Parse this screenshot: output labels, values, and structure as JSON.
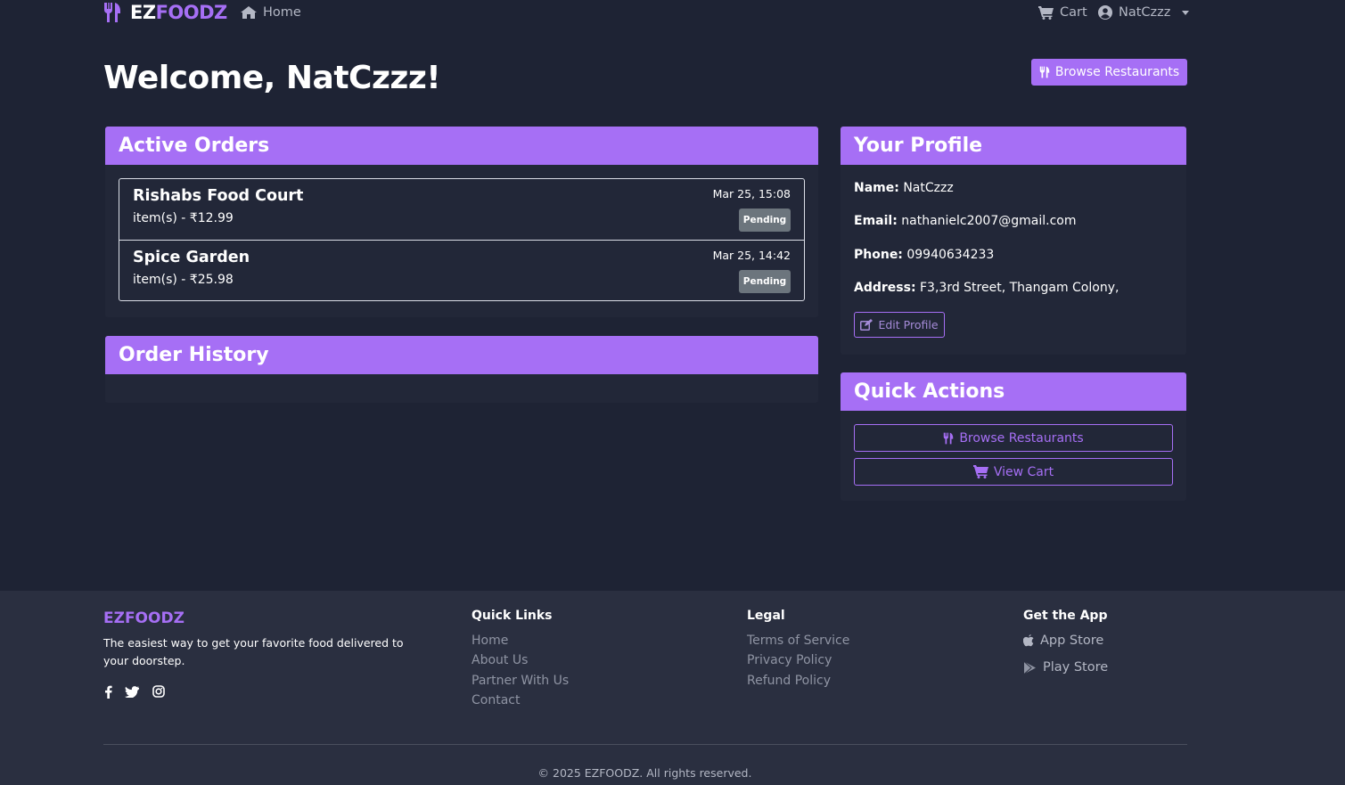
{
  "navbar": {
    "brand_ez": "EZ",
    "brand_foodz": "FOODZ",
    "home": "Home",
    "cart": "Cart",
    "user": "NatCzzz"
  },
  "main": {
    "welcome": "Welcome, NatCzzz!",
    "browse_button": "Browse Restaurants"
  },
  "active_orders": {
    "title": "Active Orders",
    "orders": [
      {
        "name": "Rishabs Food Court",
        "desc": "item(s) - ₹12.99",
        "date": "Mar 25, 15:08",
        "status": "Pending"
      },
      {
        "name": "Spice Garden",
        "desc": "item(s) - ₹25.98",
        "date": "Mar 25, 14:42",
        "status": "Pending"
      }
    ]
  },
  "order_history": {
    "title": "Order History"
  },
  "profile": {
    "title": "Your Profile",
    "name_label": "Name:",
    "name": "NatCzzz",
    "email_label": "Email:",
    "email": "nathanielc2007@gmail.com",
    "phone_label": "Phone:",
    "phone": "09940634233",
    "address_label": "Address:",
    "address": "F3,3rd Street, Thangam Colony,",
    "edit_button": "Edit Profile"
  },
  "quick_actions": {
    "title": "Quick Actions",
    "browse": "Browse Restaurants",
    "view_cart": "View Cart"
  },
  "footer": {
    "brand": "EZFOODZ",
    "tagline": "The easiest way to get your favorite food delivered to your doorstep.",
    "quick_links_title": "Quick Links",
    "quick_links": [
      "Home",
      "About Us",
      "Partner With Us",
      "Contact"
    ],
    "legal_title": "Legal",
    "legal": [
      "Terms of Service",
      "Privacy Policy",
      "Refund Policy"
    ],
    "app_title": "Get the App",
    "app_store": "App Store",
    "play_store": "Play Store",
    "copyright": "© 2025 EZFOODZ. All rights reserved."
  },
  "colors": {
    "background": "#1e2334",
    "accent": "#a66ff5",
    "card": "#222738",
    "footer": "#2a2f40",
    "badge": "#6c757d"
  },
  "icons": [
    "utensils-icon",
    "home-icon",
    "cart-icon",
    "user-circle-icon",
    "edit-icon",
    "facebook-icon",
    "twitter-icon",
    "instagram-icon",
    "apple-icon",
    "play-icon"
  ]
}
